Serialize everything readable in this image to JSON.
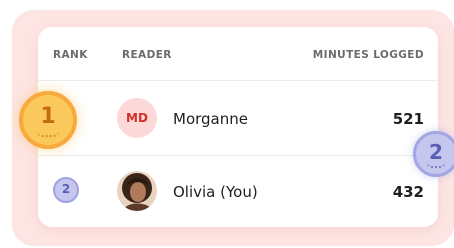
{
  "table": {
    "headers": {
      "rank": "RANK",
      "reader": "READER",
      "minutes": "MINUTES LOGGED"
    },
    "rows": [
      {
        "rank": "1",
        "avatar_initials": "MD",
        "name": "Morganne",
        "minutes": "521"
      },
      {
        "rank": "2",
        "avatar_icon": "profile-photo",
        "name": "Olivia (You)",
        "minutes": "432"
      }
    ]
  },
  "badges": {
    "side_rank": "2"
  },
  "colors": {
    "panel_bg": "#fde5e3",
    "gold_medal": "#fbc95b",
    "silver_medal": "#c5c7ef",
    "initials_text": "#d1302a"
  }
}
